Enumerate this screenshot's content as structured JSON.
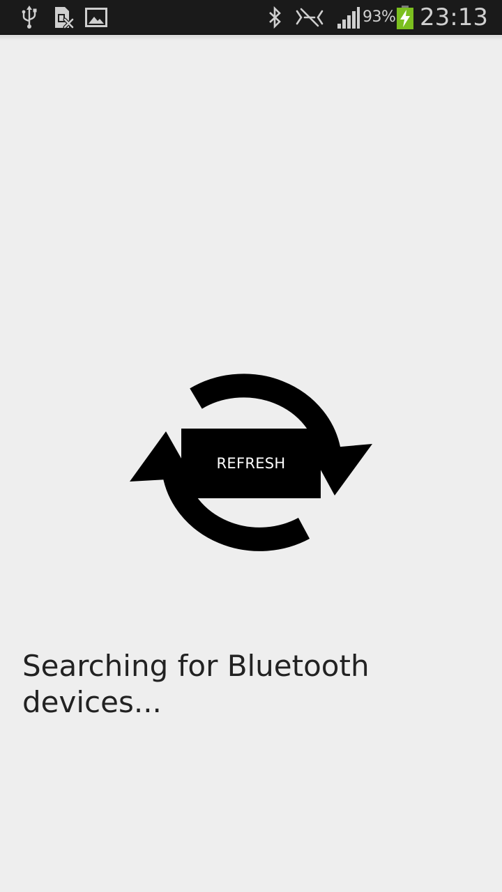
{
  "status_bar": {
    "left_icons": [
      "usb-icon",
      "sim-card-missing-icon",
      "image-icon"
    ],
    "right_icons": [
      "bluetooth-icon",
      "no-signal-icon",
      "signal-strength-icon",
      "battery-charging-icon"
    ],
    "battery_percent": "93%",
    "time": "23:13",
    "battery_color": "#7bbf1f"
  },
  "main": {
    "refresh_icon": "refresh-arrows-icon",
    "refresh_button_label": "REFRESH",
    "status_message": "Searching for Bluetooth devices..."
  }
}
